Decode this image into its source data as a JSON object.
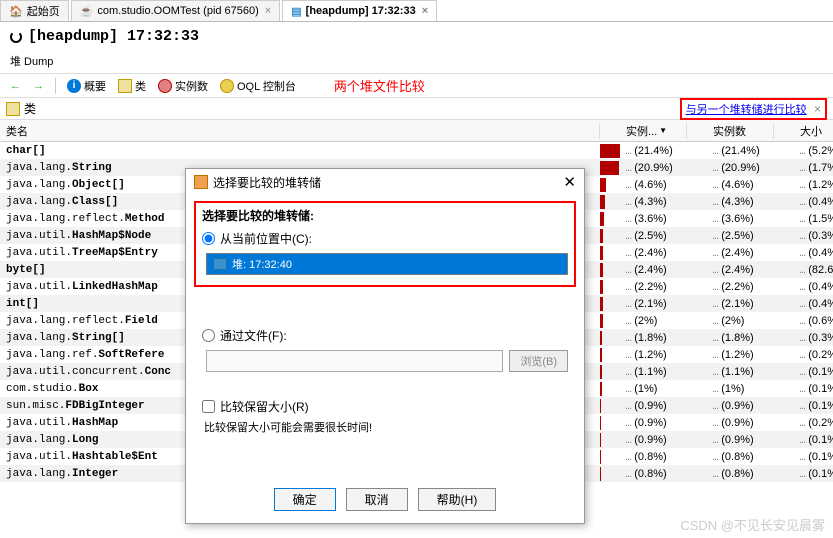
{
  "tabs": [
    {
      "label": "起始页",
      "icon": "home"
    },
    {
      "label": "com.studio.OOMTest (pid 67560)",
      "icon": "java"
    },
    {
      "label": "[heapdump] 17:32:33",
      "icon": "heap",
      "active": true
    }
  ],
  "title": "[heapdump] 17:32:33",
  "breadcrumb": "堆 Dump",
  "toolbar": {
    "overview": "概要",
    "classes": "类",
    "instances": "实例数",
    "oql": "OQL 控制台"
  },
  "annotation": "两个堆文件比较",
  "subtoolbar": {
    "classes_label": "类",
    "compare_link": "与另一个堆转储进行比较"
  },
  "table": {
    "headers": {
      "name": "类名",
      "inst_bar": "实例...",
      "instances": "实例数",
      "size": "大小"
    },
    "sort_icon": "▼",
    "rows": [
      {
        "pkg": "",
        "cls": "char[]",
        "bar": 20,
        "pct1": "(21.4%)",
        "pct2": "(5.2%)"
      },
      {
        "pkg": "java.lang.",
        "cls": "String",
        "bar": 19,
        "pct1": "(20.9%)",
        "pct2": "(1.7%)"
      },
      {
        "pkg": "java.lang.",
        "cls": "Object[]",
        "bar": 6,
        "pct1": "(4.6%)",
        "pct2": "(1.2%)"
      },
      {
        "pkg": "java.lang.",
        "cls": "Class[]",
        "bar": 5,
        "pct1": "(4.3%)",
        "pct2": "(0.4%)"
      },
      {
        "pkg": "java.lang.reflect.",
        "cls": "Method",
        "bar": 4,
        "pct1": "(3.6%)",
        "pct2": "(1.5%)"
      },
      {
        "pkg": "java.util.",
        "cls": "HashMap$Node",
        "bar": 3,
        "pct1": "(2.5%)",
        "pct2": "(0.3%)"
      },
      {
        "pkg": "java.util.",
        "cls": "TreeMap$Entry",
        "bar": 3,
        "pct1": "(2.4%)",
        "pct2": "(0.4%)"
      },
      {
        "pkg": "",
        "cls": "byte[]",
        "bar": 3,
        "pct1": "(2.4%)",
        "pct2": "(82.6%)"
      },
      {
        "pkg": "java.util.",
        "cls": "LinkedHashMap",
        "bar": 3,
        "pct1": "(2.2%)",
        "pct2": "(0.4%)"
      },
      {
        "pkg": "",
        "cls": "int[]",
        "bar": 3,
        "pct1": "(2.1%)",
        "pct2": "(0.4%)"
      },
      {
        "pkg": "java.lang.reflect.",
        "cls": "Field",
        "bar": 3,
        "pct1": "(2%)",
        "pct2": "(0.6%)"
      },
      {
        "pkg": "java.lang.",
        "cls": "String[]",
        "bar": 2,
        "pct1": "(1.8%)",
        "pct2": "(0.3%)"
      },
      {
        "pkg": "java.lang.ref.",
        "cls": "SoftRefere",
        "bar": 2,
        "pct1": "(1.2%)",
        "pct2": "(0.2%)"
      },
      {
        "pkg": "java.util.concurrent.",
        "cls": "Conc",
        "bar": 2,
        "pct1": "(1.1%)",
        "pct2": "(0.1%)"
      },
      {
        "pkg": "com.studio.",
        "cls": "Box",
        "bar": 2,
        "pct1": "(1%)",
        "pct2": "(0.1%)"
      },
      {
        "pkg": "sun.misc.",
        "cls": "FDBigInteger",
        "bar": 1,
        "pct1": "(0.9%)",
        "pct2": "(0.1%)"
      },
      {
        "pkg": "java.util.",
        "cls": "HashMap",
        "bar": 1,
        "pct1": "(0.9%)",
        "pct2": "(0.2%)"
      },
      {
        "pkg": "java.lang.",
        "cls": "Long",
        "bar": 1,
        "pct1": "(0.9%)",
        "pct2": "(0.1%)"
      },
      {
        "pkg": "java.util.",
        "cls": "Hashtable$Ent",
        "bar": 1,
        "pct1": "(0.8%)",
        "pct2": "(0.1%)"
      },
      {
        "pkg": "java.lang.",
        "cls": "Integer",
        "bar": 1,
        "pct1": "(0.8%)",
        "pct2": "(0.1%)"
      }
    ]
  },
  "dialog": {
    "title": "选择要比较的堆转储",
    "label": "选择要比较的堆转储:",
    "radio_current": "从当前位置中(C):",
    "selected_item": "堆: 17:32:40",
    "radio_file": "通过文件(F):",
    "browse": "浏览(B)",
    "check_keep_size": "比较保留大小(R)",
    "hint": "比较保留大小可能会需要很长时间!",
    "ok": "确定",
    "cancel": "取消",
    "help": "帮助(H)"
  },
  "watermark": "CSDN @不见长安见晨雾"
}
